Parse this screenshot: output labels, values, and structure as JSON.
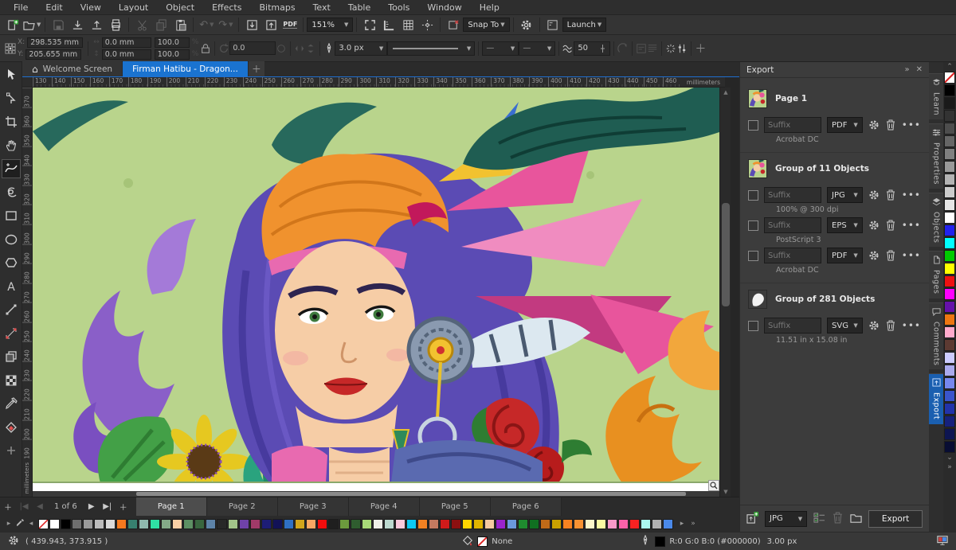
{
  "colors": {
    "accent_blue": "#1a73d0",
    "canvas_green": "#b9d48c"
  },
  "menu_bar": {
    "items": [
      "File",
      "Edit",
      "View",
      "Layout",
      "Object",
      "Effects",
      "Bitmaps",
      "Text",
      "Table",
      "Tools",
      "Window",
      "Help"
    ]
  },
  "standard_toolbar": {
    "zoom_level": "151%",
    "pdf_label": "PDF",
    "snap_label": "Snap To",
    "launch_label": "Launch"
  },
  "property_bar": {
    "x_label": "X:",
    "y_label": "Y:",
    "x_value": "298.535 mm",
    "y_value": "205.655 mm",
    "width_value": "0.0 mm",
    "height_value": "0.0 mm",
    "scale_x_value": "100.0",
    "scale_y_value": "100.0",
    "percent": "%",
    "angle_value": "0.0",
    "outline_width_value": "3.0 px",
    "smoothing_value": "50"
  },
  "document_tabs": {
    "tabs": [
      {
        "label": "Welcome Screen",
        "active": false,
        "icon": "home"
      },
      {
        "label": "Firman Hatibu - Dragon...",
        "active": true,
        "icon": null
      }
    ]
  },
  "rulers": {
    "units_label": "millimeters",
    "horizontal_ticks": [
      130,
      140,
      150,
      160,
      170,
      180,
      190,
      200,
      210,
      220,
      230,
      240,
      250,
      260,
      270,
      280,
      290,
      300,
      310,
      320,
      330,
      340,
      350,
      360,
      370,
      380,
      390,
      400,
      410,
      420,
      430,
      440,
      450,
      460
    ],
    "vertical_ticks": [
      370,
      360,
      350,
      340,
      330,
      320,
      310,
      300,
      290,
      280,
      270,
      260,
      250,
      240,
      230,
      220,
      210,
      200,
      190
    ]
  },
  "toolbox": {
    "tools": [
      {
        "name": "pick-tool",
        "active": false
      },
      {
        "name": "shape-tool",
        "active": false
      },
      {
        "name": "crop-tool",
        "active": false
      },
      {
        "name": "pan-tool",
        "active": false
      },
      {
        "name": "curve-tool",
        "active": true
      },
      {
        "name": "artistic-media-tool",
        "active": false
      },
      {
        "name": "rectangle-tool",
        "active": false
      },
      {
        "name": "ellipse-tool",
        "active": false
      },
      {
        "name": "polygon-tool",
        "active": false
      },
      {
        "name": "text-tool",
        "active": false
      },
      {
        "name": "connector-tool",
        "active": false
      },
      {
        "name": "dimension-tool",
        "active": false
      },
      {
        "name": "drop-shadow-tool",
        "active": false
      },
      {
        "name": "mesh-fill-tool",
        "active": false
      },
      {
        "name": "eyedropper-tool",
        "active": false
      },
      {
        "name": "interactive-fill-tool",
        "active": false
      },
      {
        "name": "add-tool",
        "active": false
      }
    ]
  },
  "export_docker": {
    "title": "Export",
    "items": [
      {
        "name": "Page 1",
        "thumb": "colorful",
        "rows": [
          {
            "placeholder": "Suffix",
            "format": "PDF",
            "detail": "Acrobat DC"
          }
        ]
      },
      {
        "name": "Group of 11 Objects",
        "thumb": "colorful",
        "rows": [
          {
            "placeholder": "Suffix",
            "format": "JPG",
            "detail": "100% @ 300 dpi"
          },
          {
            "placeholder": "Suffix",
            "format": "EPS",
            "detail": "PostScript 3"
          },
          {
            "placeholder": "Suffix",
            "format": "PDF",
            "detail": "Acrobat DC"
          }
        ]
      },
      {
        "name": "Group of 281 Objects",
        "thumb": "white",
        "rows": [
          {
            "placeholder": "Suffix",
            "format": "SVG",
            "detail": "11.51 in x 15.08 in"
          }
        ]
      }
    ],
    "footer": {
      "format": "JPG",
      "export_label": "Export"
    }
  },
  "docker_tabs": {
    "tabs": [
      {
        "label": "Learn",
        "active": false
      },
      {
        "label": "Properties",
        "active": false
      },
      {
        "label": "Objects",
        "active": false
      },
      {
        "label": "Pages",
        "active": false
      },
      {
        "label": "Comments",
        "active": false
      },
      {
        "label": "Export",
        "active": true
      }
    ]
  },
  "page_navigator": {
    "counter": "1 of 6",
    "pages": [
      "Page 1",
      "Page 2",
      "Page 3",
      "Page 4",
      "Page 5",
      "Page 6"
    ],
    "active_index": 0
  },
  "bottom_palette": {
    "colors": [
      "none",
      "#ffffff",
      "#000000",
      "#6e6e6e",
      "#9a9a9a",
      "#bcbcbc",
      "#dadada",
      "#f4791f",
      "#37806f",
      "#8fb9ae",
      "#2fe0a4",
      "#84a987",
      "#f9d0a5",
      "#5d9063",
      "#39663f",
      "#5d83a8",
      "#282828",
      "#a2c489",
      "#6f42a8",
      "#a03a68",
      "#1d1d76",
      "#121257",
      "#2f70c4",
      "#d2a51b",
      "#f9a763",
      "#f20d0d",
      "#1f1f1f",
      "#6c9a3d",
      "#2f5d2f",
      "#a8d878",
      "#efefe8",
      "#bcd9cf",
      "#f9c9dc",
      "#0cc9f2",
      "#f28122",
      "#c47a60",
      "#d01a1a",
      "#8c1010",
      "#ffd400",
      "#e0b400",
      "#f5c9a1",
      "#9a23cc",
      "#6b99dd",
      "#1f8a2f",
      "#107021",
      "#c06a18",
      "#c9a100",
      "#f58221",
      "#f89232",
      "#fdf6c9",
      "#fafaa2",
      "#f899c9",
      "#f862a9",
      "#f82222",
      "#aaf8f0",
      "#b1b1b1",
      "#4a89e9"
    ]
  },
  "right_palette": {
    "colors": [
      "none",
      "#000000",
      "#1a1a1a",
      "#333333",
      "#4d4d4d",
      "#666666",
      "#808080",
      "#999999",
      "#b3b3b3",
      "#cccccc",
      "#e6e6e6",
      "#ffffff",
      "#2222ee",
      "#00ffff",
      "#00cc00",
      "#ffff00",
      "#ee1111",
      "#ff00ff",
      "#6611aa",
      "#ee7711",
      "#ffaacc",
      "#5d3a32",
      "#ccccff",
      "#aaaaee",
      "#7788ee",
      "#3a55cc",
      "#2233aa",
      "#16217c",
      "#0d1552",
      "#080d33"
    ]
  },
  "status_bar": {
    "coordinates": "( 439.943, 373.915 )",
    "fill_label": "None",
    "outline_color_text": "R:0 G:0 B:0 (#000000)",
    "outline_width_text": "3.00 px"
  }
}
